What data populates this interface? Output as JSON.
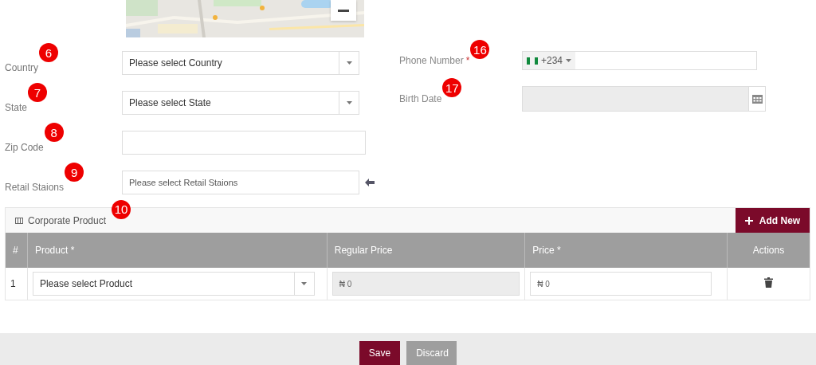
{
  "left_fields": [
    {
      "label": "Country",
      "badge": "6",
      "kind": "select",
      "placeholder": "Please select Country"
    },
    {
      "label": "State",
      "badge": "7",
      "kind": "select",
      "placeholder": "Please select State"
    },
    {
      "label": "Zip Code",
      "badge": "8",
      "kind": "text"
    },
    {
      "label": "Retail Staions",
      "badge": "9",
      "kind": "lookup",
      "placeholder": "Please select Retail Staions"
    }
  ],
  "right_fields": [
    {
      "label": "Phone Number",
      "required_mark": "*",
      "badge": "16",
      "kind": "phone",
      "dial_code": "+234"
    },
    {
      "label": "Birth Date",
      "badge": "17",
      "kind": "date"
    }
  ],
  "section": {
    "title": "Corporate Product",
    "badge": "10",
    "add_button": "Add New"
  },
  "table": {
    "columns": [
      "#",
      "Product *",
      "Regular Price",
      "Price *",
      "Actions"
    ],
    "rows": [
      {
        "index": "1",
        "product_placeholder": "Please select Product",
        "regular_price": "₦ 0",
        "price": "₦ 0"
      }
    ]
  },
  "footer": {
    "buttons": [
      {
        "label": "Save",
        "kind": "primary"
      },
      {
        "label": "Discard",
        "kind": "secondary"
      }
    ]
  }
}
